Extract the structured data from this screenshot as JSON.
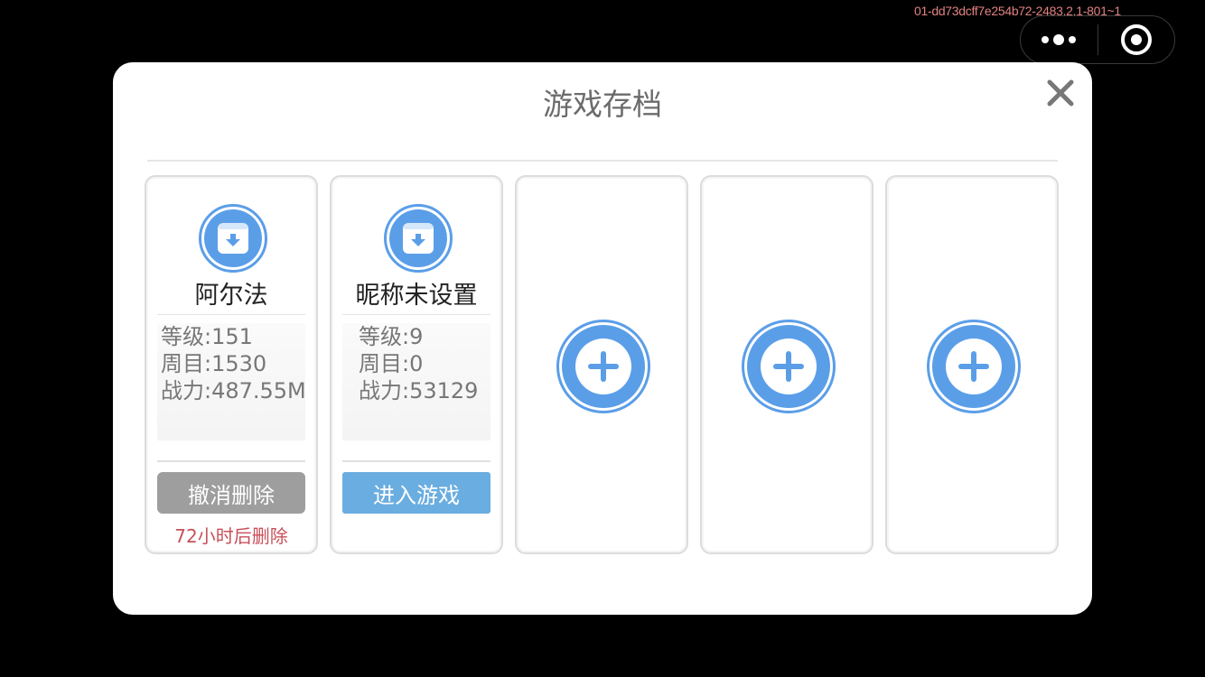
{
  "debug_id": "01-dd73dcff7e254b72-2483.2.1-801~1",
  "capsule": {
    "more_icon": "more-dots-icon",
    "close_icon": "target-close-icon"
  },
  "dialog": {
    "title": "游戏存档",
    "close_icon": "close-x-icon",
    "colors": {
      "accent": "#5b9ee8",
      "danger": "#c8505a",
      "enter": "#6aade0",
      "undo": "#9e9e9e"
    }
  },
  "slots": [
    {
      "name": "阿尔法",
      "level": "等级:151",
      "round": "周目:1530",
      "power": "战力:487.55M",
      "button": "撤消删除",
      "note": "72小时后删除"
    },
    {
      "name": "昵称未设置",
      "level": "等级:9",
      "round": "周目:0",
      "power": "战力:53129",
      "button": "进入游戏"
    },
    {
      "empty": true,
      "icon": "add-plus-icon"
    },
    {
      "empty": true,
      "icon": "add-plus-icon"
    },
    {
      "empty": true,
      "icon": "add-plus-icon"
    }
  ]
}
